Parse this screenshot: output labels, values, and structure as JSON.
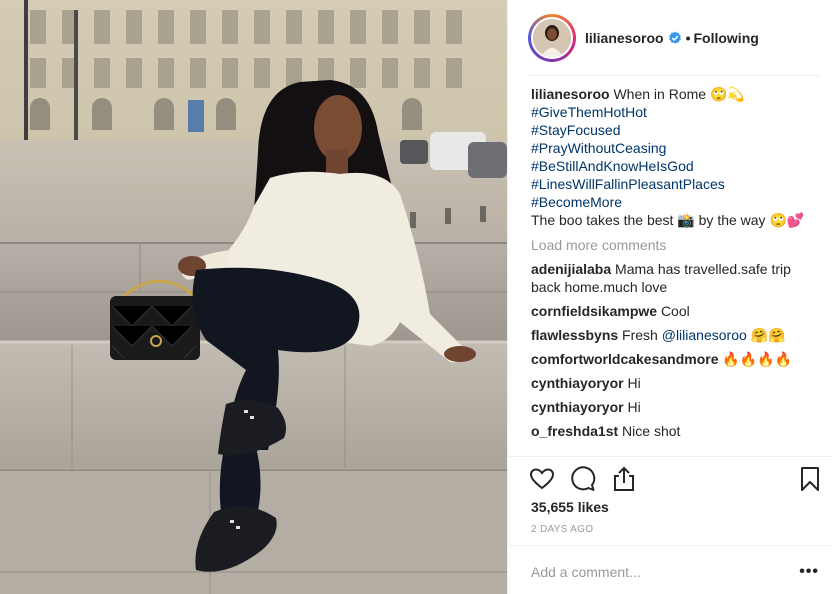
{
  "post": {
    "username": "lilianesoroo",
    "follow_separator": "•",
    "follow_label": "Following",
    "caption": {
      "user": "lilianesoroo",
      "text": "When in Rome 🙄💫",
      "hashtags": [
        "#GiveThemHotHot",
        "#StayFocused",
        "#PrayWithoutCeasing",
        "#BeStillAndKnowHeIsGod",
        "#LinesWillFallinPleasantPlaces",
        "#BecomeMore"
      ],
      "last_line": "The boo takes the best 📸 by the way 🙄💕"
    },
    "load_more_label": "Load more comments",
    "comments": [
      {
        "user": "adenijialaba",
        "text": "Mama has travelled.safe trip back home.much love"
      },
      {
        "user": "cornfieldsikampwe",
        "text": "Cool"
      },
      {
        "user": "flawlessbyns",
        "text": "Fresh ",
        "mention": "@lilianesoroo",
        "trail": " 🤗🤗"
      },
      {
        "user": "comfortworldcakesandmore",
        "text": "🔥🔥🔥🔥"
      },
      {
        "user": "cynthiayoryor",
        "text": "Hi"
      },
      {
        "user": "cynthiayoryor",
        "text": "Hi"
      },
      {
        "user": "o_freshda1st",
        "text": "Nice shot"
      }
    ],
    "likes": "35,655 likes",
    "time_ago": "2 DAYS AGO",
    "add_comment_placeholder": "Add a comment...",
    "more_label": "•••",
    "icons": {
      "like": "heart-icon",
      "comment": "comment-icon",
      "share": "share-icon",
      "save": "bookmark-icon",
      "verified": "verified-badge-icon"
    },
    "colors": {
      "link": "#003569",
      "muted": "#999999",
      "verified": "#3897f0",
      "text": "#262626"
    }
  }
}
